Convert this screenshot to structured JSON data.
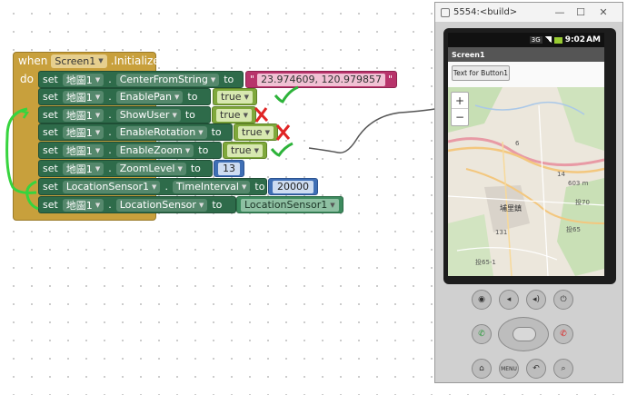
{
  "workspace": {
    "event": {
      "when_label": "when",
      "component": "Screen1",
      "event_name": ".Initialize",
      "do_label": "do"
    },
    "set_label": "set",
    "to_label": "to",
    "dot": ".",
    "statements": [
      {
        "component": "地圖1",
        "property": "CenterFromString",
        "value": "23.974609, 120.979857",
        "value_type": "text"
      },
      {
        "component": "地圖1",
        "property": "EnablePan",
        "value": "true",
        "value_type": "boolean"
      },
      {
        "component": "地圖1",
        "property": "ShowUser",
        "value": "true",
        "value_type": "boolean"
      },
      {
        "component": "地圖1",
        "property": "EnableRotation",
        "value": "true",
        "value_type": "boolean"
      },
      {
        "component": "地圖1",
        "property": "EnableZoom",
        "value": "true",
        "value_type": "boolean"
      },
      {
        "component": "地圖1",
        "property": "ZoomLevel",
        "value": "13",
        "value_type": "number"
      },
      {
        "component": "LocationSensor1",
        "property": "TimeInterval",
        "value": "20000",
        "value_type": "number"
      },
      {
        "component": "地圖1",
        "property": "LocationSensor",
        "value": "LocationSensor1",
        "value_type": "component"
      }
    ],
    "quote_mark": "\"",
    "annotation_colors": {
      "check": "#2db33a",
      "cross": "#e02424",
      "bracket": "#37d43e",
      "pen": "#555555"
    }
  },
  "emulator": {
    "window_title": "5554:<build>",
    "minimize_icon": "minimize-icon",
    "maximize_icon": "maximize-icon",
    "close_icon": "close-icon",
    "status_time": "9:02",
    "status_ampm": "AM",
    "status_badge": "3G",
    "app_title": "Screen1",
    "button_text": "Text for Button1",
    "zoom_in": "+",
    "zoom_out": "−",
    "map_labels": {
      "label_1": "埔里鎮",
      "label_2": "131",
      "label_3": "6",
      "label_4": "14",
      "label_5": "投65-1",
      "label_6": "603 m",
      "label_7": "投70",
      "label_8": "投65"
    }
  }
}
